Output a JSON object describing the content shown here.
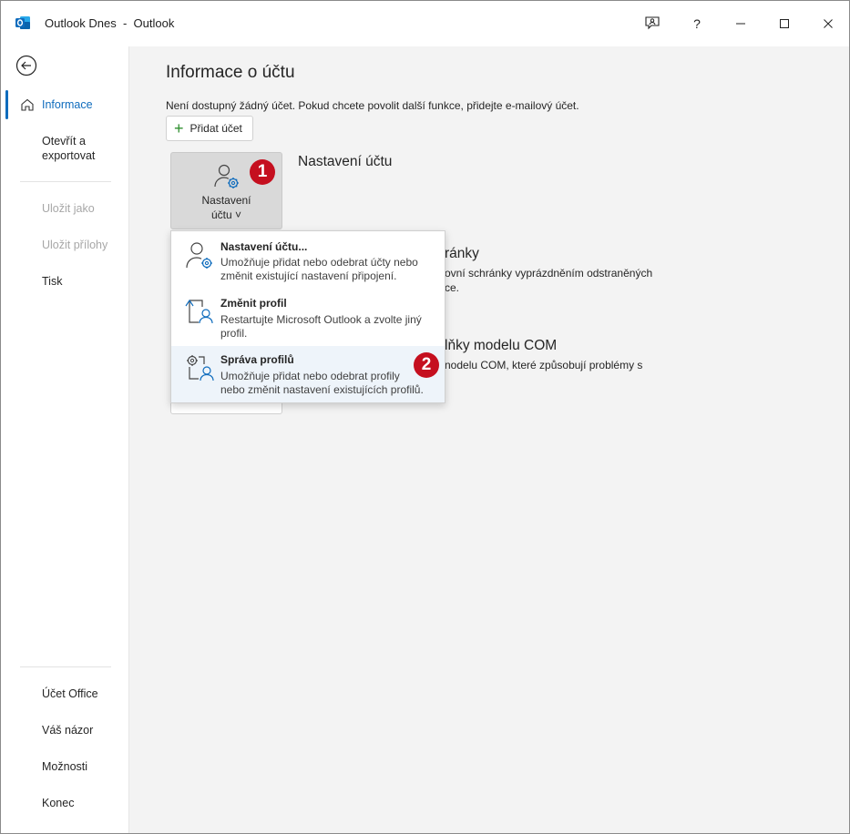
{
  "window": {
    "title": "Outlook Dnes  -  Outlook",
    "buttons": {
      "feedback": "feedback-icon",
      "help": "?",
      "minimize": "minimize-icon",
      "maximize": "maximize-icon",
      "close": "close-icon"
    }
  },
  "sidebar": {
    "items": [
      {
        "label": "Informace"
      },
      {
        "label": "Otevřít a",
        "label2": "exportovat"
      },
      {
        "label": "Uložit jako"
      },
      {
        "label": "Uložit přílohy"
      },
      {
        "label": "Tisk"
      },
      {
        "label": "Účet Office"
      },
      {
        "label": "Váš názor"
      },
      {
        "label": "Možnosti"
      },
      {
        "label": "Konec"
      }
    ]
  },
  "main": {
    "title": "Informace o účtu",
    "info": "Není dostupný žádný účet. Pokud chcete povolit další funkce, přidejte e-mailový účet.",
    "add_account": "Přidat účet",
    "account_settings_card": {
      "line1": "Nastavení",
      "line2": "účtu ˅"
    },
    "sections": [
      {
        "title": "Nastavení účtu"
      },
      {
        "title": "ránky",
        "desc1": "ovní schránky vyprázdněním odstraněných",
        "desc2": "ce."
      },
      {
        "title": "lňky modelu COM",
        "desc1": "nodelu COM, které způsobují problémy s"
      }
    ]
  },
  "dropdown": {
    "items": [
      {
        "title": "Nastavení účtu...",
        "desc1": "Umožňuje přidat nebo odebrat účty nebo",
        "desc2": "změnit existující nastavení připojení."
      },
      {
        "title": "Změnit profil",
        "desc1": "Restartujte Microsoft Outlook a zvolte jiný",
        "desc2": "profil."
      },
      {
        "title": "Správa profilů",
        "desc1": "Umožňuje přidat nebo odebrat profily",
        "desc2": "nebo změnit nastavení existujících profilů."
      }
    ]
  },
  "annotations": {
    "badge1": "1",
    "badge2": "2"
  },
  "colors": {
    "accent": "#0f6cbd",
    "badge": "#c50f1f",
    "main_bg": "#f3f3f3"
  }
}
